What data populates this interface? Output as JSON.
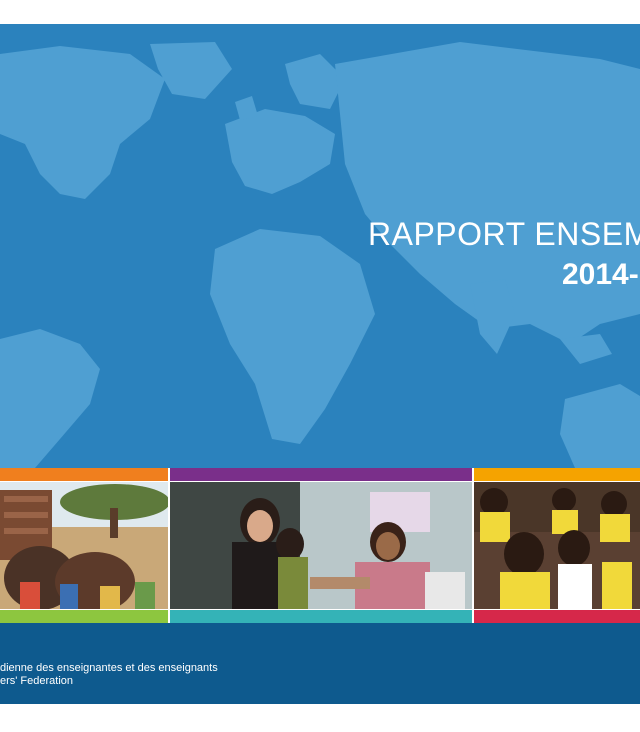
{
  "cover": {
    "title_line1": "RAPPORT ENSEM",
    "title_line2": "2014-",
    "org_line1": "dienne des enseignantes et des enseignants",
    "org_line2": "ers' Federation"
  },
  "colors": {
    "map_background": "#2b82bd",
    "map_land": "#4f9fd2",
    "footer": "#0e5a8e",
    "band_orange": "#f07f1e",
    "band_purple": "#7a2f8a",
    "band_gold": "#f5a300",
    "band_green": "#8dc63f",
    "band_teal": "#34b3b7",
    "band_red": "#d6284a"
  },
  "photos": [
    {
      "name": "children-outdoor-photo"
    },
    {
      "name": "teachers-handshake-photo"
    },
    {
      "name": "classroom-children-photo"
    }
  ]
}
